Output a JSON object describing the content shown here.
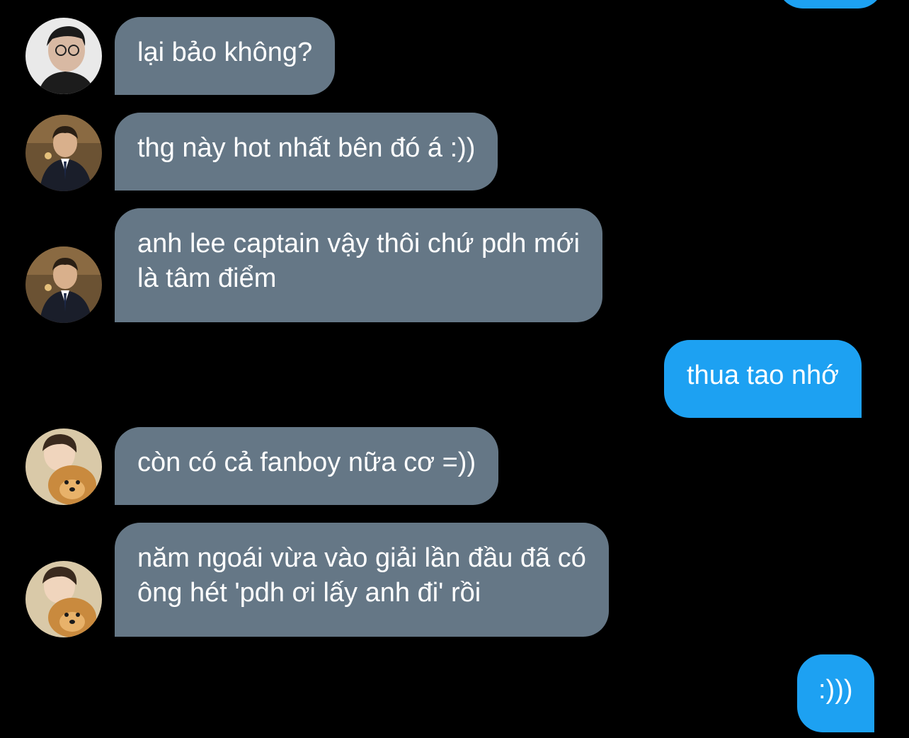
{
  "messages": [
    {
      "lines": [
        "lại bảo không?"
      ]
    },
    {
      "lines": [
        "thg này hot nhất bên đó á :))"
      ]
    },
    {
      "lines": [
        "anh lee captain vậy thôi chứ pdh mới",
        "là tâm điểm"
      ]
    },
    {
      "lines": [
        "thua tao nhớ"
      ]
    },
    {
      "lines": [
        "còn có cả fanboy nữa cơ =))"
      ]
    },
    {
      "lines": [
        "năm ngoái vừa vào giải lần đầu đã có",
        "ông hét 'pdh ơi lấy anh đi' rồi"
      ]
    },
    {
      "lines": [
        ":)))"
      ]
    }
  ],
  "colors": {
    "background": "#000000",
    "incoming_bubble": "#657786",
    "outgoing_bubble": "#1da1f2",
    "text": "#ffffff"
  }
}
